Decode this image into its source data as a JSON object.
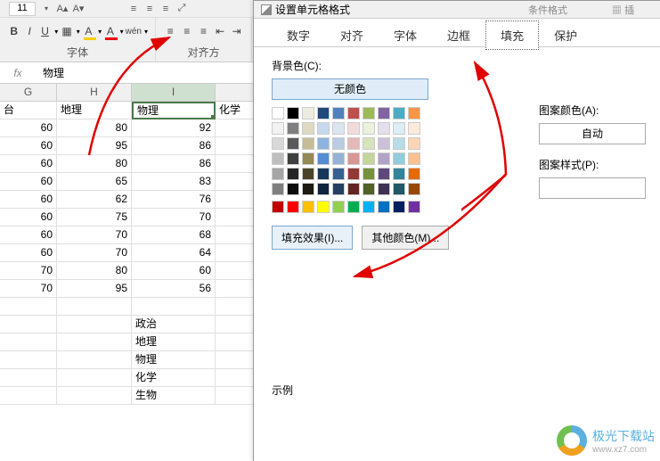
{
  "ribbon": {
    "font_size": "11",
    "b": "B",
    "i": "I",
    "u": "U",
    "wen": "wén",
    "font_group": "字体",
    "align_group": "对齐方",
    "cond_format": "条件格式"
  },
  "formula": {
    "fx": "fx",
    "value": "物理"
  },
  "sheet": {
    "cols": [
      "G",
      "H",
      "I"
    ],
    "headers": [
      "台",
      "地理",
      "物理",
      "化学"
    ],
    "rows": [
      [
        60,
        80,
        92
      ],
      [
        60,
        95,
        86
      ],
      [
        60,
        80,
        86
      ],
      [
        60,
        65,
        83
      ],
      [
        60,
        62,
        76
      ],
      [
        60,
        75,
        70
      ],
      [
        60,
        70,
        68
      ],
      [
        60,
        70,
        64
      ],
      [
        70,
        80,
        60
      ],
      [
        70,
        95,
        56
      ]
    ],
    "list": [
      "政治",
      "地理",
      "物理",
      "化学",
      "生物"
    ]
  },
  "dialog": {
    "title": "设置单元格格式",
    "tabs": [
      "数字",
      "对齐",
      "字体",
      "边框",
      "填充",
      "保护"
    ],
    "bg_label": "背景色(C):",
    "no_color": "无颜色",
    "fill_effect": "填充效果(I)...",
    "other_color": "其他颜色(M)...",
    "pattern_color": "图案颜色(A):",
    "auto": "自动",
    "pattern_style": "图案样式(P):",
    "sample": "示例"
  },
  "ribbon_hints": {
    "a": "条件格式",
    "b": "插"
  },
  "theme_row1": [
    "#ffffff",
    "#000000",
    "#eeece1",
    "#1f497d",
    "#4f81bd",
    "#c0504d",
    "#9bbb59",
    "#8064a2",
    "#4bacc6",
    "#f79646"
  ],
  "tints": [
    [
      "#f2f2f2",
      "#7f7f7f",
      "#ddd9c3",
      "#c6d9f0",
      "#dbe5f1",
      "#f2dcdb",
      "#ebf1dd",
      "#e5e0ec",
      "#dbeef3",
      "#fdeada"
    ],
    [
      "#d8d8d8",
      "#595959",
      "#c4bd97",
      "#8db3e2",
      "#b8cce4",
      "#e5b9b7",
      "#d7e3bc",
      "#ccc1d9",
      "#b7dde8",
      "#fbd5b5"
    ],
    [
      "#bfbfbf",
      "#3f3f3f",
      "#938953",
      "#548dd4",
      "#95b3d7",
      "#d99694",
      "#c3d69b",
      "#b2a2c7",
      "#92cddc",
      "#fac08f"
    ],
    [
      "#a5a5a5",
      "#262626",
      "#494429",
      "#17365d",
      "#366092",
      "#953734",
      "#76923c",
      "#5f497a",
      "#31859b",
      "#e36c09"
    ],
    [
      "#7f7f7f",
      "#0c0c0c",
      "#1d1b10",
      "#0f243e",
      "#244061",
      "#632423",
      "#4f6128",
      "#3f3151",
      "#205867",
      "#974806"
    ]
  ],
  "std_colors": [
    "#c00000",
    "#ff0000",
    "#ffc000",
    "#ffff00",
    "#92d050",
    "#00b050",
    "#00b0f0",
    "#0070c0",
    "#002060",
    "#7030a0"
  ],
  "watermark": {
    "name": "极光下载站",
    "url": "www.xz7.com"
  }
}
